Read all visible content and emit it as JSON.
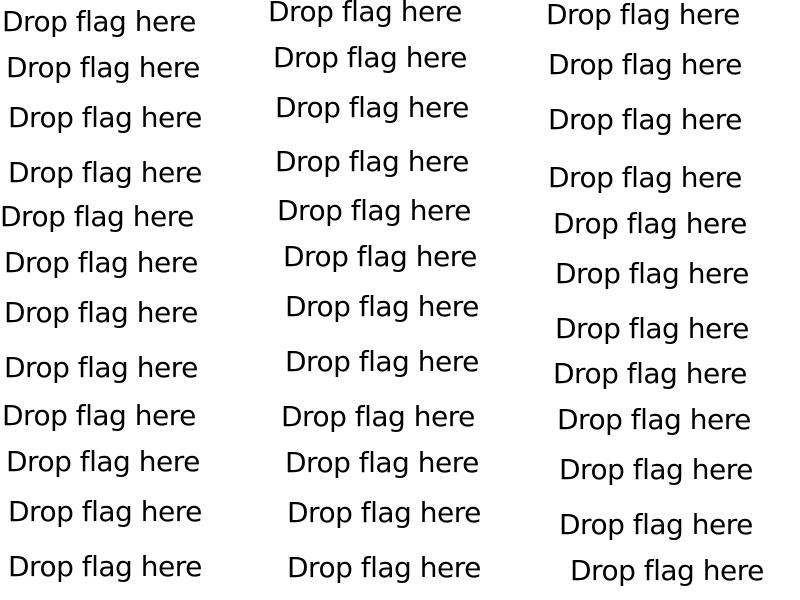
{
  "columns": [
    {
      "zones": [
        {
          "label": "Drop flag here"
        },
        {
          "label": "Drop flag here"
        },
        {
          "label": "Drop flag here"
        },
        {
          "label": "Drop flag here"
        },
        {
          "label": "Drop flag here"
        },
        {
          "label": "Drop flag here"
        },
        {
          "label": "Drop flag here"
        },
        {
          "label": "Drop flag here"
        },
        {
          "label": "Drop flag here"
        },
        {
          "label": "Drop flag here"
        },
        {
          "label": "Drop flag here"
        },
        {
          "label": "Drop flag here"
        }
      ]
    },
    {
      "zones": [
        {
          "label": "Drop flag here"
        },
        {
          "label": "Drop flag here"
        },
        {
          "label": "Drop flag here"
        },
        {
          "label": "Drop flag here"
        },
        {
          "label": "Drop flag here"
        },
        {
          "label": "Drop flag here"
        },
        {
          "label": "Drop flag here"
        },
        {
          "label": "Drop flag here"
        },
        {
          "label": "Drop flag here"
        },
        {
          "label": "Drop flag here"
        },
        {
          "label": "Drop flag here"
        },
        {
          "label": "Drop flag here"
        }
      ]
    },
    {
      "zones": [
        {
          "label": "Drop flag here"
        },
        {
          "label": "Drop flag here"
        },
        {
          "label": "Drop flag here"
        },
        {
          "label": "Drop flag here"
        },
        {
          "label": "Drop flag here"
        },
        {
          "label": "Drop flag here"
        },
        {
          "label": "Drop flag here"
        },
        {
          "label": "Drop flag here"
        },
        {
          "label": "Drop flag here"
        },
        {
          "label": "Drop flag here"
        },
        {
          "label": "Drop flag here"
        },
        {
          "label": "Drop flag here"
        }
      ]
    }
  ]
}
